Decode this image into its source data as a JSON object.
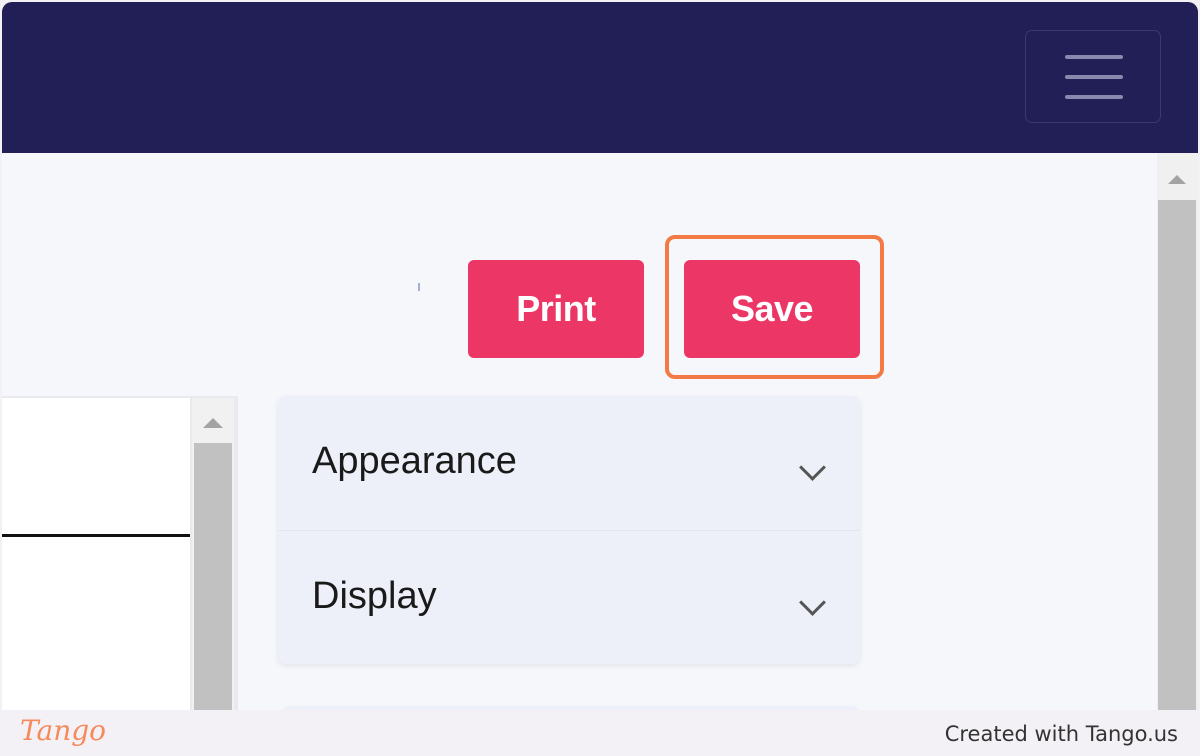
{
  "header": {
    "menu_icon": "hamburger-menu-icon",
    "background_color": "#221f57"
  },
  "actions": {
    "print_label": "Print",
    "save_label": "Save",
    "button_color": "#ec3665",
    "highlight_color": "#f47a45"
  },
  "settings": {
    "sections": [
      {
        "label": "Appearance",
        "icon": "chevron-down-icon"
      },
      {
        "label": "Display",
        "icon": "chevron-down-icon"
      }
    ]
  },
  "footer": {
    "logo": "Tango",
    "credit": "Created with Tango.us"
  }
}
